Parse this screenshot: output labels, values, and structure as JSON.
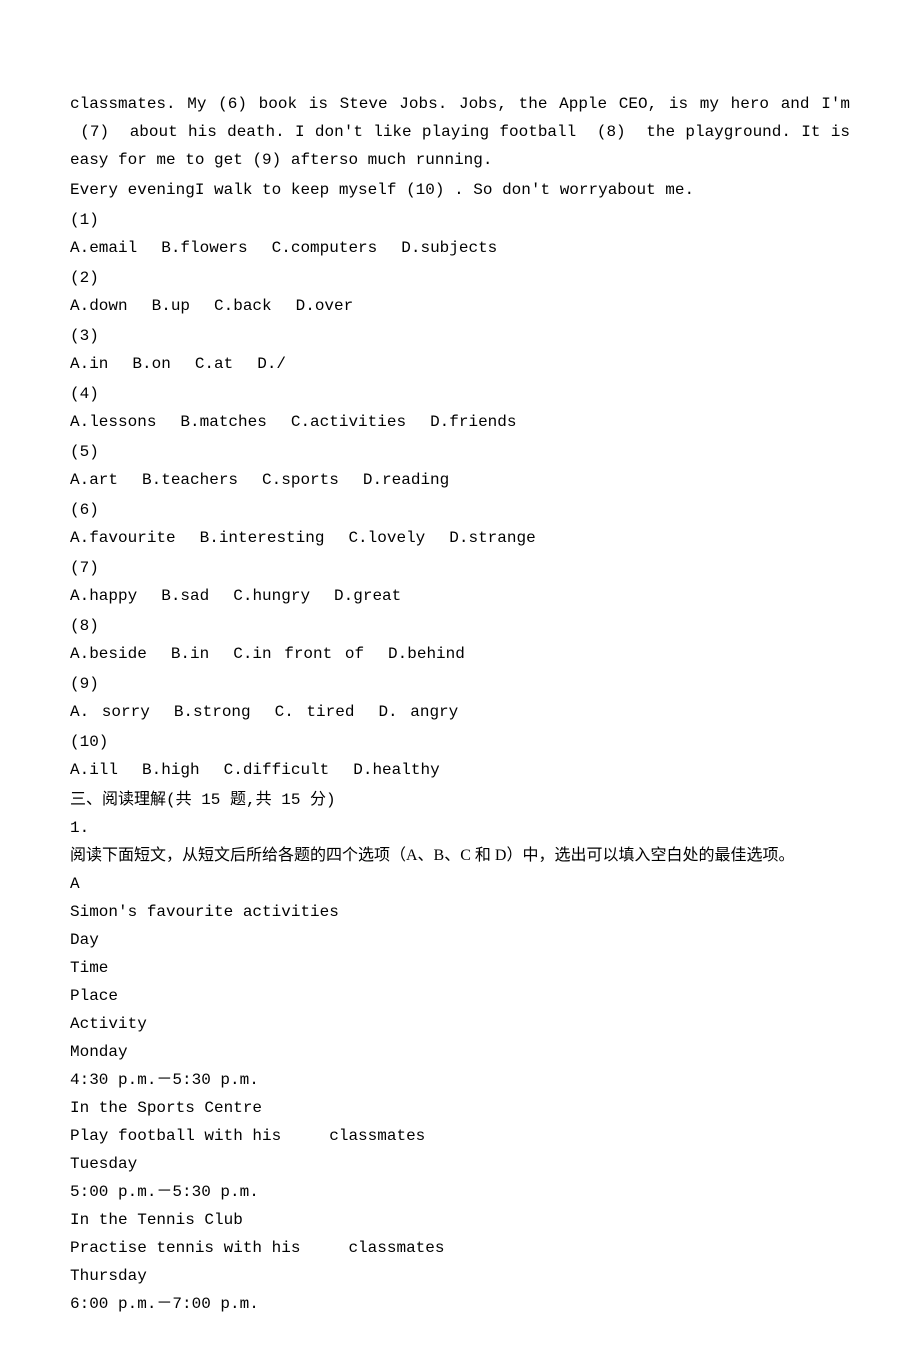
{
  "passage": {
    "line1a": "classmates. My ",
    "blank6": "(6)",
    "line1b": " book is Steve Jobs. Jobs, the Apple CEO, is my hero and",
    "line2a": "I'm ",
    "blank7": "(7)",
    "line2b": " about his death. I don't like playing football ",
    "blank8": "(8)",
    "line2c": " the",
    "line3a": "playground. It is easy for me to get ",
    "blank9": "(9)",
    "line3b": " afterso much running.",
    "line4a": "Every eveningI walk to keep myself ",
    "blank10": "(10)",
    "line4b": " . So don't worryabout me."
  },
  "questions": [
    {
      "num": "(1)",
      "opts": [
        {
          "l": "A.email"
        },
        {
          "l": "B.flowers"
        },
        {
          "l": "C.computers"
        },
        {
          "l": "D.subjects"
        }
      ]
    },
    {
      "num": "(2)",
      "opts": [
        {
          "l": "A.down"
        },
        {
          "l": "B.up"
        },
        {
          "l": "C.back"
        },
        {
          "l": "D.over"
        }
      ]
    },
    {
      "num": "(3)",
      "opts": [
        {
          "l": "A.in"
        },
        {
          "l": "B.on"
        },
        {
          "l": "C.at"
        },
        {
          "l": "D./"
        }
      ]
    },
    {
      "num": "(4)",
      "opts": [
        {
          "l": "A.lessons"
        },
        {
          "l": "B.matches"
        },
        {
          "l": "C.activities"
        },
        {
          "l": "D.friends"
        }
      ]
    },
    {
      "num": "(5)",
      "opts": [
        {
          "l": "A.art"
        },
        {
          "l": "B.teachers"
        },
        {
          "l": "C.sports"
        },
        {
          "l": "D.reading"
        }
      ]
    },
    {
      "num": "(6)",
      "opts": [
        {
          "l": "A.favourite"
        },
        {
          "l": "B.interesting"
        },
        {
          "l": "C.lovely"
        },
        {
          "l": "D.strange"
        }
      ]
    },
    {
      "num": "(7)",
      "opts": [
        {
          "l": "A.happy"
        },
        {
          "l": "B.sad"
        },
        {
          "l": "C.hungry"
        },
        {
          "l": "D.great"
        }
      ]
    },
    {
      "num": "(8)",
      "opts": [
        {
          "l": "A.beside"
        },
        {
          "l": "B.in"
        },
        {
          "l": "C.in front of"
        },
        {
          "l": "D.behind"
        }
      ]
    },
    {
      "num": "(9)",
      "opts": [
        {
          "l": "A. sorry"
        },
        {
          "l": "B.strong"
        },
        {
          "l": "C. tired"
        },
        {
          "l": "D. angry"
        }
      ]
    },
    {
      "num": "(10)",
      "opts": [
        {
          "l": "A.ill"
        },
        {
          "l": "B.high"
        },
        {
          "l": "C.difficult"
        },
        {
          "l": "D.healthy"
        }
      ]
    }
  ],
  "section3": {
    "heading": "三、阅读理解(共 15 题,共 15 分)",
    "qnum": "1.",
    "instruction": "阅读下面短文，从短文后所给各题的四个选项（A、B、C 和 D）中，选出可以填入空白处的最佳选项。",
    "passage_letter": "A",
    "title": "Simon's favourite activities",
    "headers": [
      "Day",
      "Time",
      "Place",
      "Activity"
    ],
    "rows": [
      {
        "day": "Monday",
        "time": "4:30 p.m.－5:30 p.m.",
        "place": "In the Sports Centre",
        "activity_pre": "Play football with his",
        "activity_post": "classmates"
      },
      {
        "day": "Tuesday",
        "time": "5:00 p.m.－5:30 p.m.",
        "place": "In the Tennis Club",
        "activity_pre": "Practise tennis with his",
        "activity_post": "classmates"
      },
      {
        "day": "Thursday",
        "time": "6:00 p.m.－7:00 p.m."
      }
    ]
  }
}
